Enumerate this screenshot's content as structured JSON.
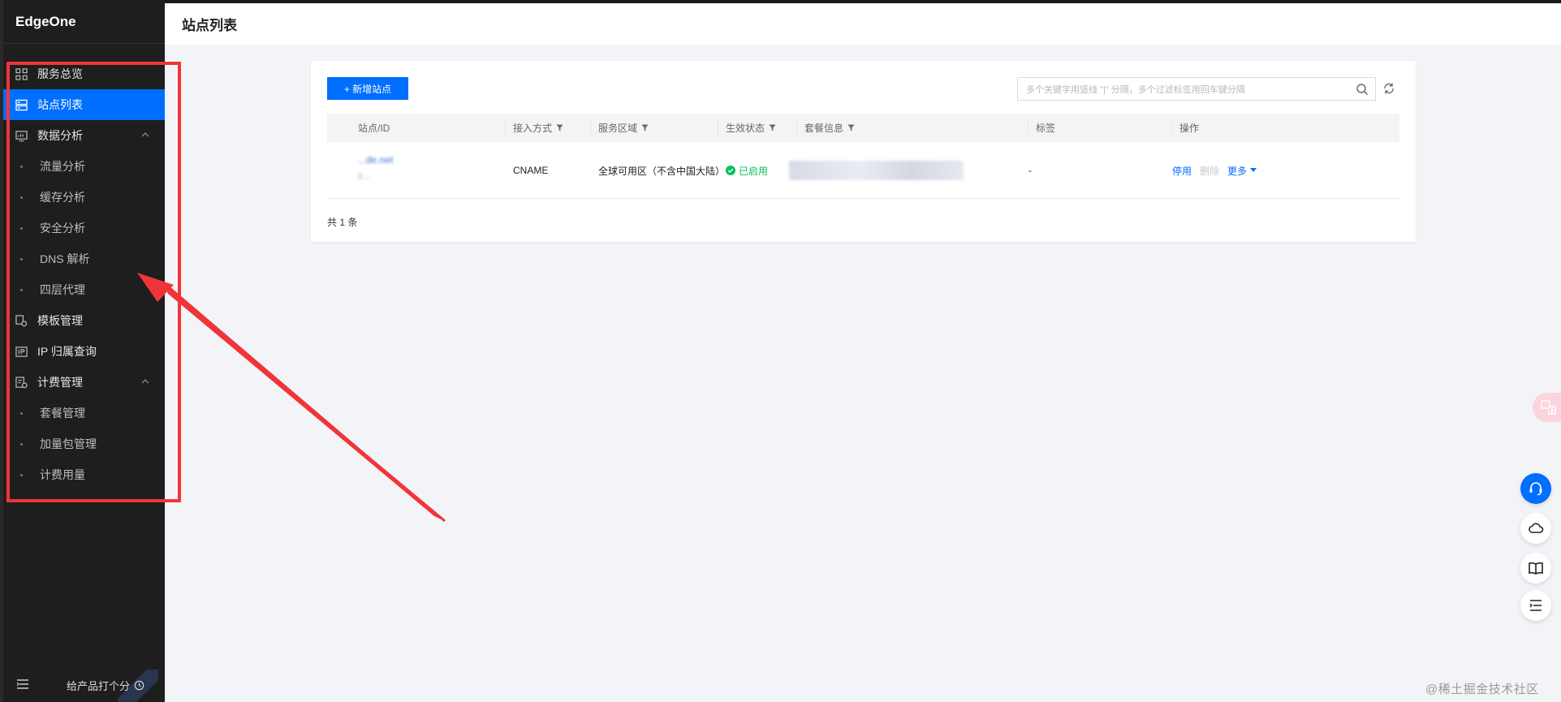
{
  "app": {
    "brand": "EdgeOne",
    "page_title": "站点列表"
  },
  "sidebar": {
    "items": [
      {
        "label": "服务总览",
        "icon": "grid-icon",
        "type": "main",
        "active": false
      },
      {
        "label": "站点列表",
        "icon": "server-list-icon",
        "type": "main",
        "active": true
      },
      {
        "label": "数据分析",
        "icon": "monitor-chart-icon",
        "type": "main",
        "active": false,
        "expanded": true
      },
      {
        "label": "流量分析",
        "type": "sub"
      },
      {
        "label": "缓存分析",
        "type": "sub"
      },
      {
        "label": "安全分析",
        "type": "sub"
      },
      {
        "label": "DNS 解析",
        "type": "sub"
      },
      {
        "label": "四层代理",
        "type": "sub"
      },
      {
        "label": "模板管理",
        "icon": "template-icon",
        "type": "main",
        "active": false
      },
      {
        "label": "IP 归属查询",
        "icon": "ip-icon",
        "type": "main",
        "active": false
      },
      {
        "label": "计费管理",
        "icon": "billing-icon",
        "type": "main",
        "active": false,
        "expanded": true
      },
      {
        "label": "套餐管理",
        "type": "sub"
      },
      {
        "label": "加量包管理",
        "type": "sub"
      },
      {
        "label": "计费用量",
        "type": "sub"
      }
    ],
    "footer": {
      "rate_label": "给产品打个分"
    }
  },
  "toolbar": {
    "add_label": "+ 新增站点",
    "search_placeholder": "多个关键字用竖线 \"|\" 分隔，多个过滤标签用回车键分隔"
  },
  "table": {
    "columns": [
      "站点/ID",
      "接入方式",
      "服务区域",
      "生效状态",
      "套餐信息",
      "标签",
      "操作"
    ],
    "rows": [
      {
        "site_name": "...de.net",
        "site_id": "z...",
        "access": "CNAME",
        "region": "全球可用区（不含中国大陆）",
        "status": "已启用",
        "tags": "-",
        "ops": {
          "disable": "停用",
          "delete": "删除",
          "more": "更多"
        }
      }
    ],
    "total": "共 1 条"
  },
  "watermark": "@稀土掘金技术社区",
  "colors": {
    "accent": "#006eff",
    "sidebar_bg": "#1e1e1e",
    "annotation": "#f0353a",
    "success": "#0abf5b"
  }
}
